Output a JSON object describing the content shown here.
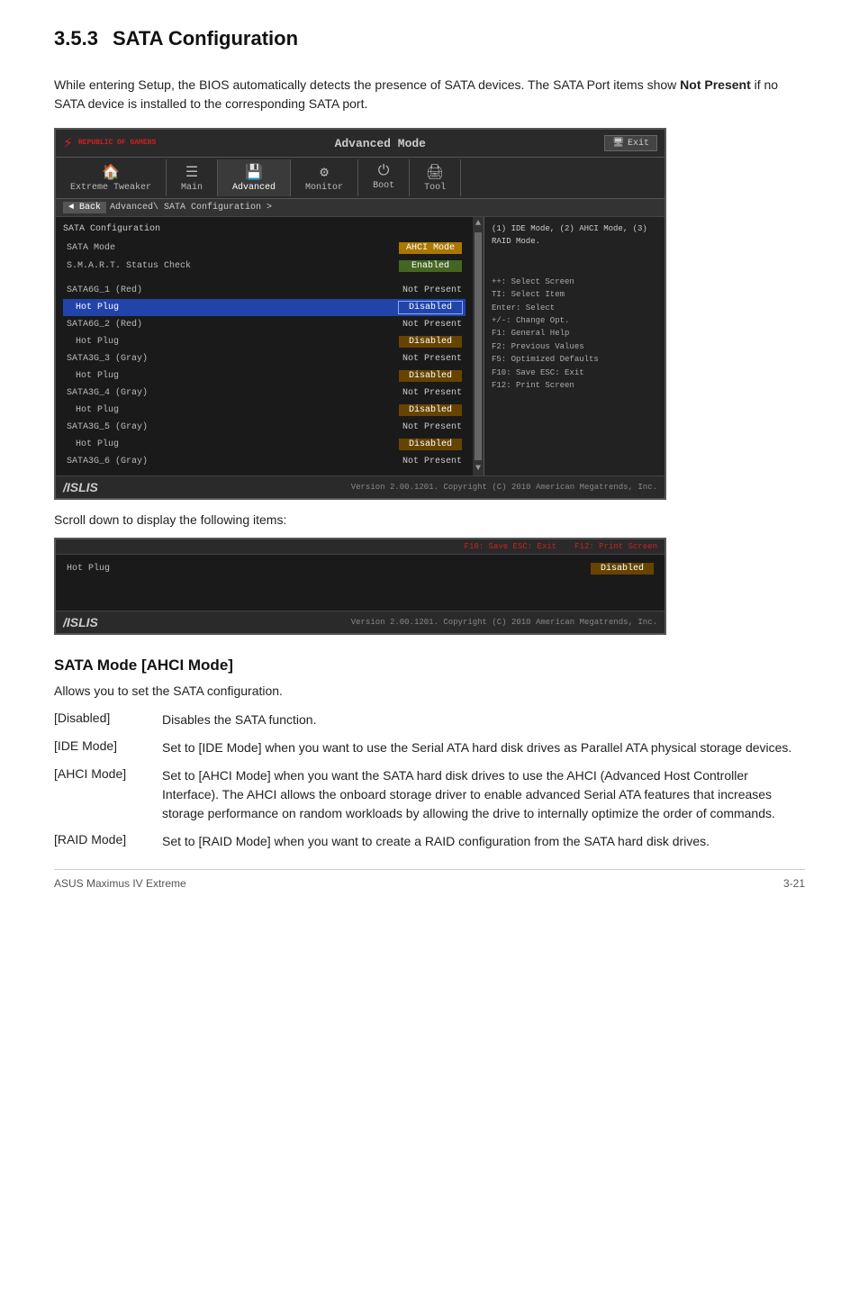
{
  "section": {
    "number": "3.5.3",
    "title": "SATA Configuration",
    "intro": "While entering Setup, the BIOS automatically detects the presence of SATA devices. The SATA Port items show ",
    "intro_bold": "Not Present",
    "intro_end": " if no SATA device is installed to the corresponding SATA port."
  },
  "bios": {
    "mode": "Advanced Mode",
    "exit_label": "Exit",
    "logo_text": "REPUBLIC OF\nGAMERS",
    "nav_items": [
      {
        "label": "Extreme Tweaker",
        "icon": "🏠"
      },
      {
        "label": "Main",
        "icon": "☰"
      },
      {
        "label": "Advanced",
        "icon": "💾"
      },
      {
        "label": "Monitor",
        "icon": "⚙"
      },
      {
        "label": "Boot",
        "icon": "⏻"
      },
      {
        "label": "Tool",
        "icon": "🖨"
      }
    ],
    "breadcrumb_back": "◄ Back",
    "breadcrumb_path": "Advanced\\ SATA Configuration >",
    "section_label": "SATA Configuration",
    "right_help": "(1) IDE Mode, (2) AHCI Mode, (3)\nRAID Mode.",
    "rows": [
      {
        "label": "SATA Mode",
        "value": "AHCI Mode",
        "type": "badge_yellow"
      },
      {
        "label": "S.M.A.R.T. Status Check",
        "value": "Enabled",
        "type": "badge_green"
      },
      {
        "label": "",
        "value": "",
        "type": "spacer"
      },
      {
        "label": "SATA6G_1 (Red)",
        "value": "Not Present",
        "type": "text"
      },
      {
        "label": "  Hot Plug",
        "value": "Disabled",
        "type": "badge_disabled",
        "highlighted": true
      },
      {
        "label": "SATA6G_2 (Red)",
        "value": "Not Present",
        "type": "text"
      },
      {
        "label": "  Hot Plug",
        "value": "Disabled",
        "type": "badge_disabled"
      },
      {
        "label": "SATA3G_3 (Gray)",
        "value": "Not Present",
        "type": "text"
      },
      {
        "label": "  Hot Plug",
        "value": "Disabled",
        "type": "badge_disabled"
      },
      {
        "label": "SATA3G_4 (Gray)",
        "value": "Not Present",
        "type": "text"
      },
      {
        "label": "  Hot Plug",
        "value": "Disabled",
        "type": "badge_disabled"
      },
      {
        "label": "SATA3G_5 (Gray)",
        "value": "Not Present",
        "type": "text"
      },
      {
        "label": "  Hot Plug",
        "value": "Disabled",
        "type": "badge_disabled"
      },
      {
        "label": "SATA3G_6 (Gray)",
        "value": "Not Present",
        "type": "text"
      }
    ],
    "sidebar_help": "++: Select Screen\nTI: Select Item\nEnter: Select\n+/-: Change Opt.\nF1: General Help\nF2: Previous Values\nF5: Optimized Defaults\nF10: Save  ESC: Exit\nF12: Print Screen",
    "footer": "Version 2.00.1201. Copyright (C) 2010 American Megatrends, Inc.",
    "asus_logo": "/ISLIS"
  },
  "bios_small": {
    "row_label": "Hot Plug",
    "row_value": "Disabled",
    "top_help": "F10: Save  ESC: Exit",
    "top_help2": "F12: Print Screen",
    "footer": "Version 2.00.1201. Copyright (C) 2010 American Megatrends, Inc.",
    "asus_logo": "/ISLIS"
  },
  "scroll_note": "Scroll down to display the following items:",
  "sata_mode": {
    "title": "SATA Mode [AHCI Mode]",
    "intro": "Allows you to set the SATA configuration.",
    "definitions": [
      {
        "term": "[Disabled]",
        "desc": "Disables the SATA function."
      },
      {
        "term": "[IDE Mode]",
        "desc": "Set to [IDE Mode] when you want to use the Serial ATA hard disk drives as Parallel ATA physical storage devices."
      },
      {
        "term": "[AHCI Mode]",
        "desc": "Set to [AHCI Mode] when you want the SATA hard disk drives to use the AHCI (Advanced Host Controller Interface). The AHCI allows the onboard storage driver to enable advanced Serial ATA features that increases storage performance on random workloads by allowing the drive to internally optimize the order of commands."
      },
      {
        "term": "[RAID Mode]",
        "desc": "Set to [RAID Mode] when you want to create a RAID configuration from the SATA hard disk drives."
      }
    ]
  },
  "footer": {
    "left": "ASUS Maximus IV Extreme",
    "right": "3-21"
  }
}
